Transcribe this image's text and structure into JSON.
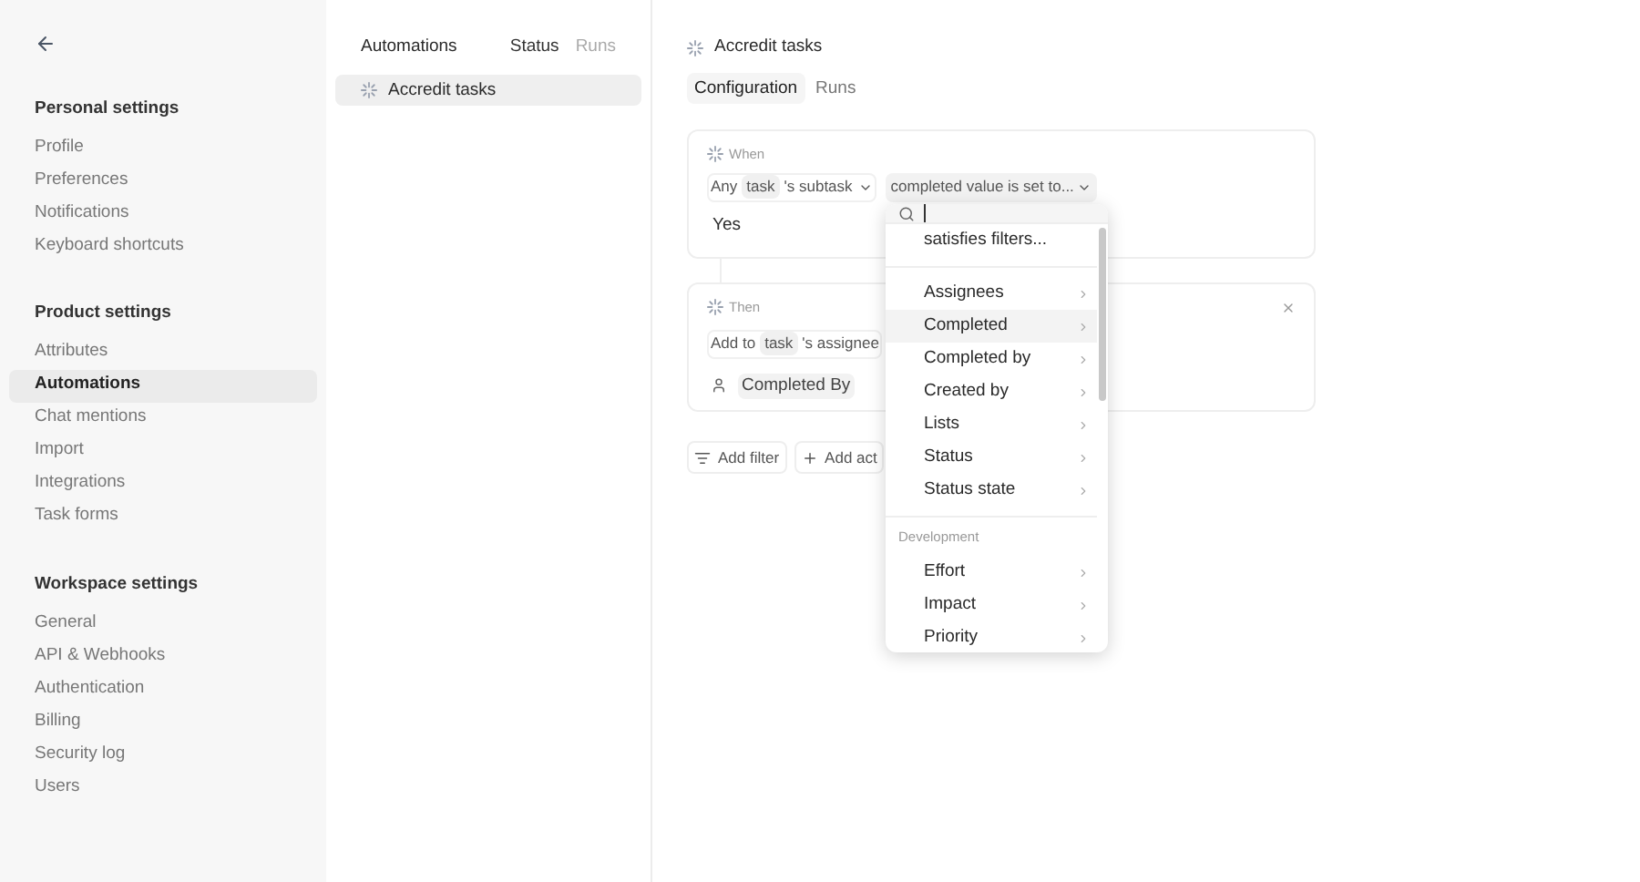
{
  "sidebar": {
    "sections": [
      {
        "title": "Personal settings",
        "items": [
          {
            "label": "Profile",
            "selected": false
          },
          {
            "label": "Preferences",
            "selected": false
          },
          {
            "label": "Notifications",
            "selected": false
          },
          {
            "label": "Keyboard shortcuts",
            "selected": false
          }
        ]
      },
      {
        "title": "Product settings",
        "items": [
          {
            "label": "Attributes",
            "selected": false
          },
          {
            "label": "Automations",
            "selected": true
          },
          {
            "label": "Chat mentions",
            "selected": false
          },
          {
            "label": "Import",
            "selected": false
          },
          {
            "label": "Integrations",
            "selected": false
          },
          {
            "label": "Task forms",
            "selected": false
          }
        ]
      },
      {
        "title": "Workspace settings",
        "items": [
          {
            "label": "General",
            "selected": false
          },
          {
            "label": "API & Webhooks",
            "selected": false
          },
          {
            "label": "Authentication",
            "selected": false
          },
          {
            "label": "Billing",
            "selected": false
          },
          {
            "label": "Security log",
            "selected": false
          },
          {
            "label": "Users",
            "selected": false
          }
        ]
      }
    ]
  },
  "list": {
    "title": "Automations",
    "columns": [
      "Status",
      "Runs"
    ],
    "items": [
      {
        "label": "Accredit tasks",
        "selected": true
      }
    ]
  },
  "main": {
    "title": "Accredit tasks",
    "tabs": [
      {
        "label": "Configuration",
        "selected": true
      },
      {
        "label": "Runs",
        "selected": false
      }
    ],
    "when": {
      "label": "When",
      "subject": {
        "prefix": "Any",
        "token": "task",
        "suffix": "'s subtask"
      },
      "condition": "completed value is set to...",
      "value": "Yes"
    },
    "then": {
      "label": "Then",
      "action": {
        "prefix": "Add to",
        "token": "task",
        "suffix": "'s assignee"
      },
      "value": "Completed By"
    },
    "buttons": [
      "Add filter",
      "Add act"
    ]
  },
  "dropdown": {
    "items": [
      {
        "kind": "option",
        "label": "satisfies filters...",
        "selected": false
      },
      {
        "kind": "divider"
      },
      {
        "kind": "submenu",
        "label": "Assignees",
        "selected": false
      },
      {
        "kind": "submenu",
        "label": "Completed",
        "selected": true
      },
      {
        "kind": "submenu",
        "label": "Completed by",
        "selected": false
      },
      {
        "kind": "submenu",
        "label": "Created by",
        "selected": false
      },
      {
        "kind": "submenu",
        "label": "Lists",
        "selected": false
      },
      {
        "kind": "submenu",
        "label": "Status",
        "selected": false
      },
      {
        "kind": "submenu",
        "label": "Status state",
        "selected": false
      },
      {
        "kind": "divider"
      },
      {
        "kind": "group",
        "label": "Development"
      },
      {
        "kind": "submenu",
        "label": "Effort",
        "selected": false
      },
      {
        "kind": "submenu",
        "label": "Impact",
        "selected": false
      },
      {
        "kind": "submenu",
        "label": "Priority",
        "selected": false
      }
    ]
  }
}
